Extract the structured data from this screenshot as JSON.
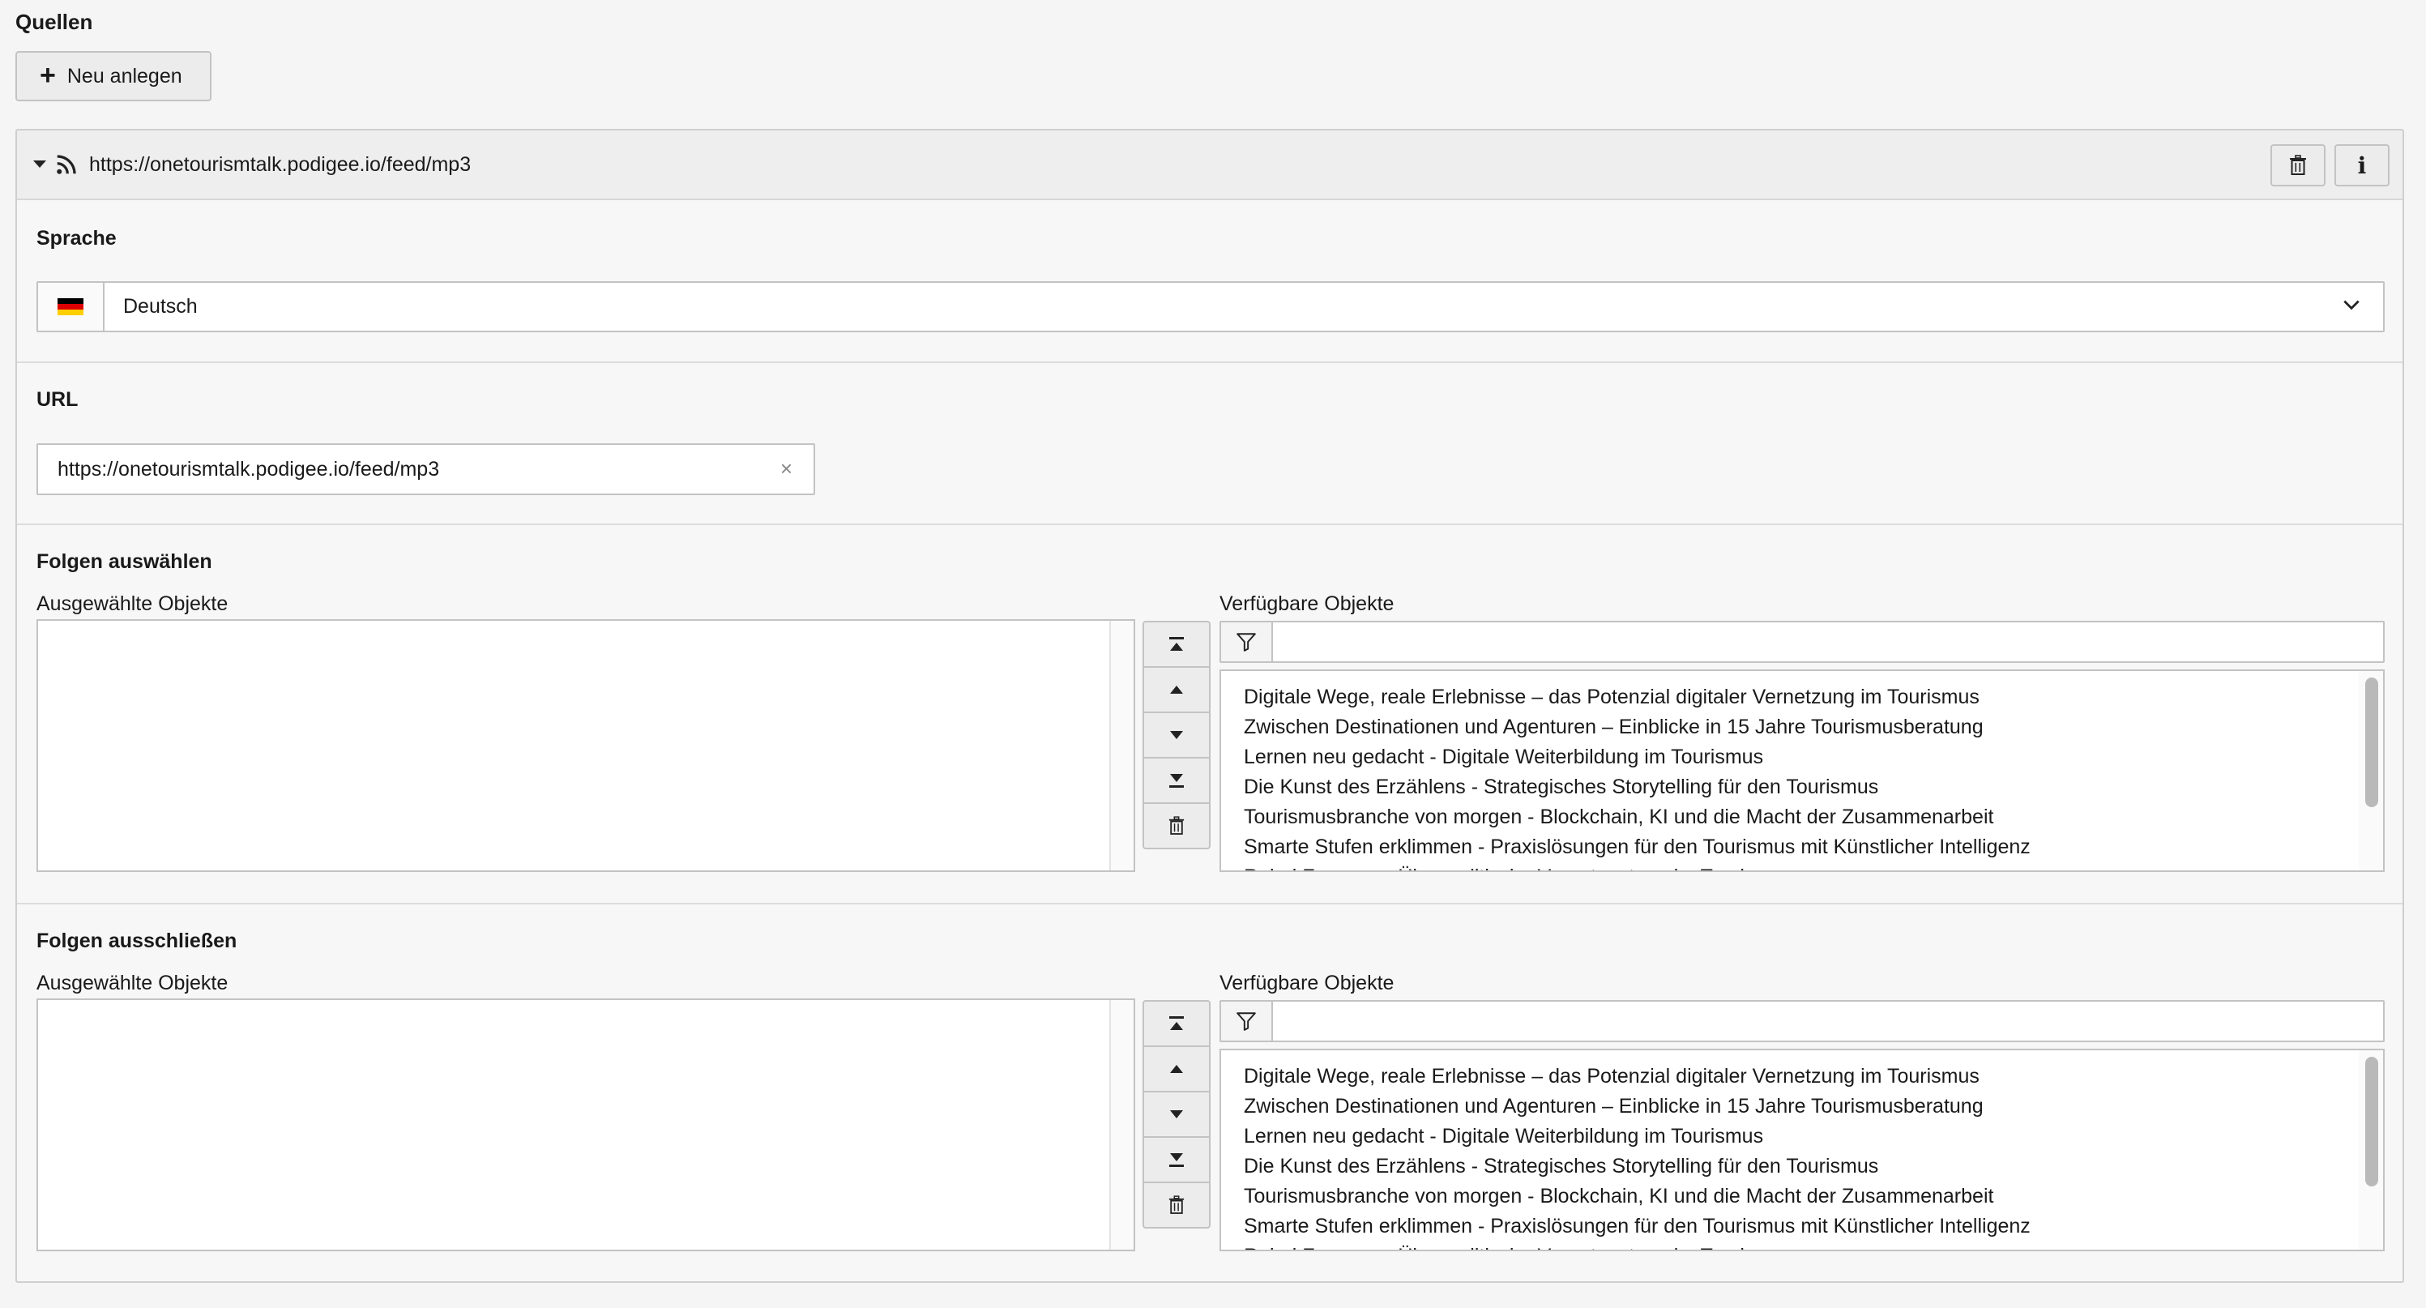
{
  "section": {
    "title": "Quellen",
    "new_button": "Neu anlegen"
  },
  "record": {
    "title": "https://onetourismtalk.podigee.io/feed/mp3",
    "language": {
      "label": "Sprache",
      "value": "Deutsch"
    },
    "url": {
      "label": "URL",
      "value": "https://onetourismtalk.podigee.io/feed/mp3"
    },
    "include": {
      "label": "Folgen auswählen",
      "selected_label": "Ausgewählte Objekte",
      "available_label": "Verfügbare Objekte",
      "filter_value": ""
    },
    "exclude": {
      "label": "Folgen ausschließen",
      "selected_label": "Ausgewählte Objekte",
      "available_label": "Verfügbare Objekte",
      "filter_value": ""
    },
    "episodes": [
      "Digitale Wege, reale Erlebnisse – das Potenzial digitaler Vernetzung im Tourismus",
      "Zwischen Destinationen und Agenturen – Einblicke in 15 Jahre Tourismusberatung",
      "Lernen neu gedacht - Digitale Weiterbildung im Tourismus",
      "Die Kunst des Erzählens - Strategisches Storytelling für den Tourismus",
      "Tourismusbranche von morgen - Blockchain, KI und die Macht der Zusammenarbeit",
      "Smarte Stufen erklimmen - Praxislösungen für den Tourismus mit Künstlicher Intelligenz",
      "Rebel Freeway - Über politische Verantwortung im Tourismus"
    ]
  },
  "icons": {
    "rss": "rss-icon",
    "trash": "trash-icon",
    "info": "info-icon",
    "flag": "flag-de-icon",
    "chevron": "chevron-down-icon",
    "clear": "close-icon",
    "filter": "filter-icon",
    "move_top": "move-top-icon",
    "move_up": "move-up-icon",
    "move_down": "move-down-icon",
    "move_bottom": "move-bottom-icon"
  },
  "colors": {
    "background": "#f5f5f5",
    "header": "#eeeeee",
    "border": "#c3c3c3"
  }
}
